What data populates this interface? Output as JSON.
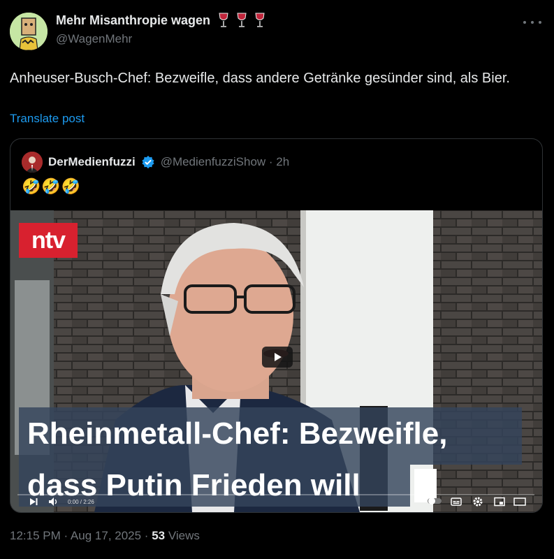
{
  "author": {
    "name": "Mehr Misanthropie wagen",
    "handle": "@WagenMehr",
    "name_icons": [
      "wine-glass-icon",
      "wine-glass-icon",
      "wine-glass-icon"
    ]
  },
  "post": {
    "text": "Anheuser-Busch-Chef: Bezweifle, dass andere Getränke gesünder sind, als Bier.",
    "translate_label": "Translate post"
  },
  "quote": {
    "name": "DerMedienfuzzi",
    "handle": "@MedienfuzziShow · 2h",
    "text": "🤣🤣🤣",
    "video": {
      "channel_logo": "ntv",
      "caption_line1": "Rheinmetall-Chef: Bezweifle,",
      "caption_line2": "dass Putin Frieden will",
      "time": "0:00 / 2:26"
    }
  },
  "meta": {
    "timestamp": "12:15 PM · Aug 17, 2025 · ",
    "views_count": "53",
    "views_label": " Views"
  },
  "colors": {
    "accent": "#1d9bf0",
    "muted": "#71767b",
    "text": "#e7e9ea",
    "background": "#000000"
  }
}
